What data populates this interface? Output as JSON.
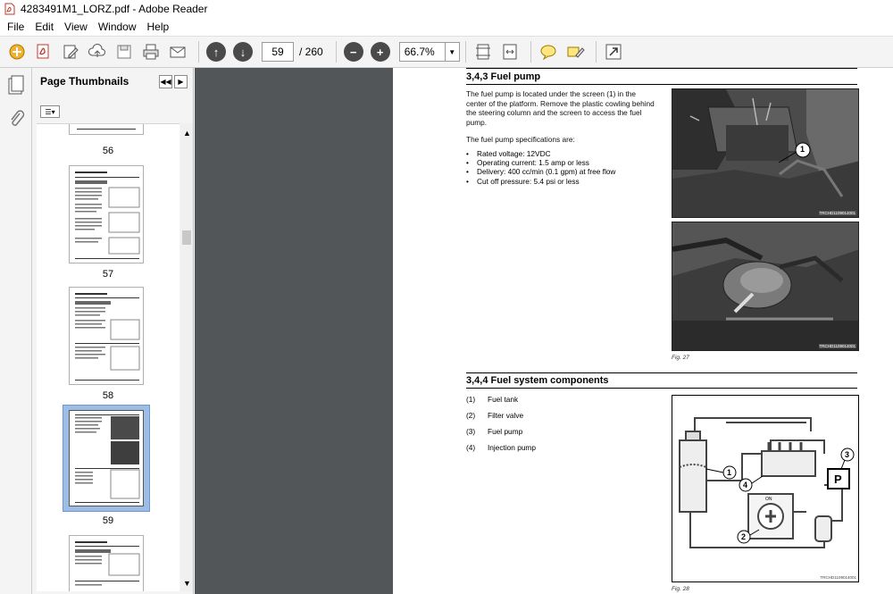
{
  "window": {
    "title": "4283491M1_LORZ.pdf - Adobe Reader"
  },
  "menu": [
    "File",
    "Edit",
    "View",
    "Window",
    "Help"
  ],
  "toolbar": {
    "current_page": "59",
    "total_pages": "/ 260",
    "zoom": "66.7%"
  },
  "sidebar": {
    "title": "Page Thumbnails",
    "thumbnails": [
      {
        "label": "56"
      },
      {
        "label": "57"
      },
      {
        "label": "58"
      },
      {
        "label": "59"
      }
    ]
  },
  "document": {
    "section1": {
      "title": "3,4,3  Fuel pump",
      "paragraph1": "The fuel pump is located under the screen (1) in the center of the platform. Remove the plastic cowling behind the steering column and the screen to access the fuel pump.",
      "paragraph2": "The fuel pump specifications are:",
      "bullets": [
        "Rated voltage: 12VDC",
        "Operating current: 1.5 amp or less",
        "Delivery: 400 cc/min (0.1 gpm) at free flow",
        "Cut off pressure: 5.4 psi or less"
      ],
      "photo1_code": "TRCHD1109014001",
      "photo2_code": "TRCHD1109014001",
      "callout": "1",
      "figure": "Fig. 27"
    },
    "section2": {
      "title": "3,4,4  Fuel system components",
      "components": [
        {
          "num": "(1)",
          "name": "Fuel tank"
        },
        {
          "num": "(2)",
          "name": "Filter valve"
        },
        {
          "num": "(3)",
          "name": "Fuel pump"
        },
        {
          "num": "(4)",
          "name": "Injection pump"
        }
      ],
      "diagram_labels": [
        "1",
        "2",
        "3",
        "4"
      ],
      "pump_letter": "P",
      "valve_text": "ON",
      "diagram_code": "TRCHD1109014001",
      "figure": "Fig. 28"
    }
  }
}
